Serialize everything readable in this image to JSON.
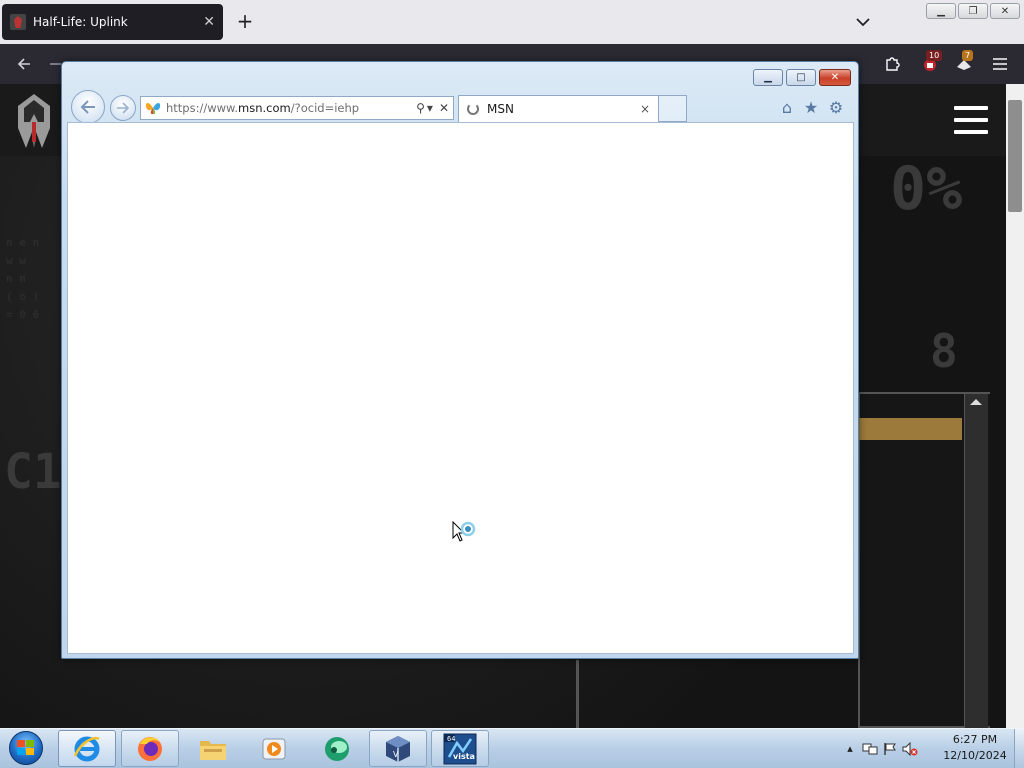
{
  "outer_browser": {
    "tab_title": "Half-Life: Uplink",
    "new_tab_symbol": "+",
    "tab_close_symbol": "✕",
    "icons": [
      "back-icon",
      "forward-icon",
      "reload-icon",
      "shield-icon",
      "lock-icon",
      "extensions-icon",
      "menu-icon"
    ],
    "badges": {
      "extension_a": "10",
      "extension_b": "7"
    },
    "window_controls": {
      "minimize": "▁",
      "restore": "❐",
      "close": "✕"
    }
  },
  "website": {
    "logo": "spartan-helmet-logo",
    "menu_icon": "hamburger-icon",
    "accent_color": "#9b7a3b"
  },
  "ie": {
    "window_controls": {
      "minimize": "▁",
      "restore": "□",
      "close": "✕"
    },
    "address": {
      "url_prefix": "https://www.",
      "url_domain": "msn.com",
      "url_suffix": "/?ocid=iehp",
      "search_symbol": "⚲",
      "dropdown_symbol": "▾",
      "stop_symbol": "✕"
    },
    "tab": {
      "label": "MSN",
      "close_symbol": "×"
    },
    "tools": {
      "home": "⌂",
      "favorites": "★",
      "settings": "⚙"
    }
  },
  "taskbar": {
    "items": [
      "start-orb",
      "internet-explorer",
      "firefox",
      "file-explorer",
      "media-player",
      "app-green",
      "virtualbox",
      "vista-x64"
    ],
    "vista_label": "vista",
    "vista_badge": "64",
    "clock": {
      "time": "6:27 PM",
      "date": "12/10/2024"
    },
    "tray_arrow": "▴"
  }
}
